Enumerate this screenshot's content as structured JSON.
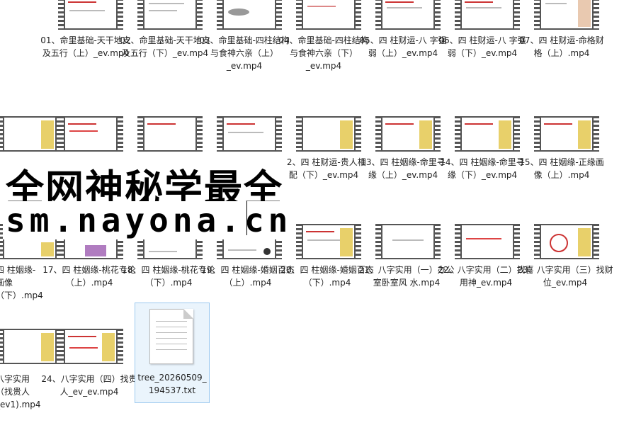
{
  "files": [
    {
      "row": 0,
      "col": 0,
      "label": "01、命里基础-天干地支及五行（上）_ev.mp4"
    },
    {
      "row": 0,
      "col": 1,
      "label": "02、命里基础-天干地支及五行（下）_ev.mp4"
    },
    {
      "row": 0,
      "col": 2,
      "label": "03、命里基础-四柱结构与食神六亲（上）_ev.mp4"
    },
    {
      "row": 0,
      "col": 3,
      "label": "04、命里基础-四柱结构与食神六亲（下）_ev.mp4"
    },
    {
      "row": 0,
      "col": 4,
      "label": "05、四 柱财运-八 字强弱（上）_ev.mp4"
    },
    {
      "row": 0,
      "col": 5,
      "label": "06、四 柱财运-八 字强弱（下）_ev.mp4"
    },
    {
      "row": 0,
      "col": 6,
      "label": "07、四 柱财运-命格财格（上）.mp4"
    },
    {
      "row": 1,
      "col": 3,
      "label": "12、四 柱财运-贵人相配（下）_ev.mp4"
    },
    {
      "row": 1,
      "col": 4,
      "label": "13、四 柱姻缘-命里寻缘（上）_ev.mp4"
    },
    {
      "row": 1,
      "col": 5,
      "label": "14、四 柱姻缘-命里寻缘（下）_ev.mp4"
    },
    {
      "row": 1,
      "col": 6,
      "label": "15、四 柱姻缘-正缘画像（上）.mp4"
    },
    {
      "row": 2,
      "col": 0,
      "label": "四 柱姻缘-画像（下）.mp4"
    },
    {
      "row": 2,
      "col": 1,
      "label": "17、四 柱姻缘-桃花专论（上）.mp4"
    },
    {
      "row": 2,
      "col": 2,
      "label": "18、四 柱姻缘-桃花专论（下）.mp4"
    },
    {
      "row": 2,
      "col": 3,
      "label": "19、四 柱姻缘-婚姻百态（上）.mp4"
    },
    {
      "row": 2,
      "col": 4,
      "label": "20、四 柱姻缘-婚姻百态（下）.mp4"
    },
    {
      "row": 2,
      "col": 5,
      "label": "21、八字实用（一）办公室卧室风 水.mp4"
    },
    {
      "row": 2,
      "col": 6,
      "label": "22、八字实用（二）找喜用神_ev.mp4"
    },
    {
      "row": 2,
      "col": 7,
      "label": "23、八字实用（三）找财位_ev.mp4"
    },
    {
      "row": 3,
      "col": 0,
      "label": "八字实用（找贵人_ev1).mp4"
    },
    {
      "row": 3,
      "col": 1,
      "label": "24、八字实用（四）找贵人_ev_ev.mp4"
    }
  ],
  "text_file": {
    "label": "tree_20260509_194537.txt"
  },
  "watermark": {
    "line1": "全网神秘学最全",
    "line2": "sm.nayona.cn"
  }
}
